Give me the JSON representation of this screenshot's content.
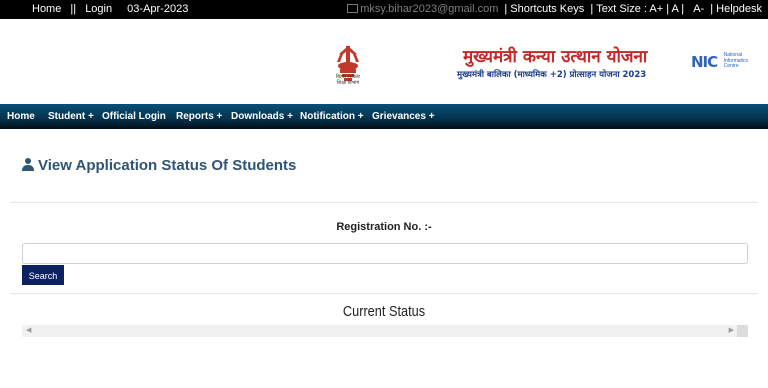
{
  "topbar": {
    "home": "Home",
    "sep1": "||",
    "login": "Login",
    "date": "03-Apr-2023",
    "email": "mksy.bihar2023@gmail.com",
    "shortcuts": "Shortcuts Keys",
    "text_size": "Text Size : A+ | A |",
    "a_minus": "A-",
    "helpdesk": "Helpdesk"
  },
  "header": {
    "emblem_caption": "बिहार सरकार शिक्षा विभाग",
    "title_main": "मुख्यमंत्री कन्या उत्थान योजना",
    "title_sub": "मुख्यमंत्री बालिका (माध्यमिक +2) प्रोत्साहन योजना 2023",
    "nic_mark": "NIC",
    "nic_line1": "National",
    "nic_line2": "Informatics",
    "nic_line3": "Centre"
  },
  "nav": {
    "home": "Home",
    "student": "Student +",
    "official_login": "Official Login",
    "reports": "Reports +",
    "downloads": "Downloads +",
    "notification": "Notification +",
    "grievances": "Grievances +"
  },
  "main": {
    "page_title": "View Application Status Of Students",
    "registration_label": "Registration No. :-",
    "registration_value": "",
    "search_label": "Search",
    "current_status": "Current Status"
  },
  "icons": {
    "user": "user-icon",
    "mail": "mail-icon",
    "scroll_left": "scroll-left-icon",
    "scroll_right": "scroll-right-icon"
  },
  "colors": {
    "topbar_bg": "#000000",
    "nav_bg": "#053550",
    "title_red": "#c62828",
    "title_blue": "#1c3d8c",
    "page_title": "#2f5474",
    "search_button": "#0c2160"
  }
}
